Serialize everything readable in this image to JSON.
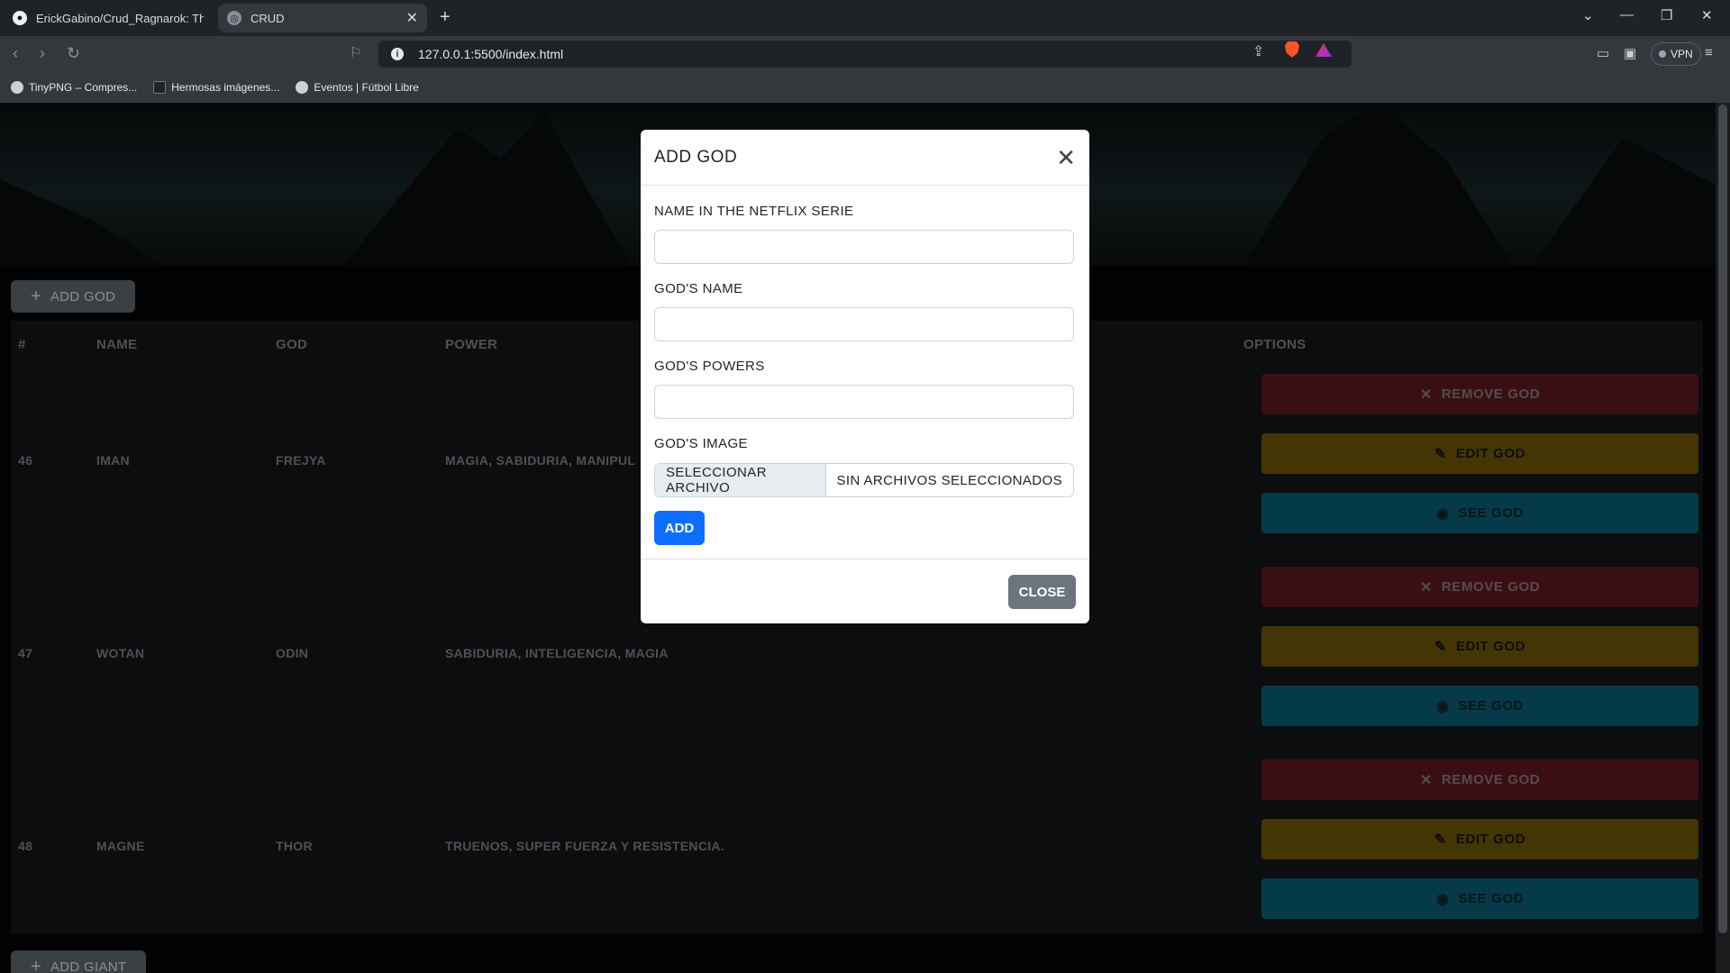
{
  "browser": {
    "tabs": [
      {
        "label": "ErickGabino/Crud_Ragnarok: This is",
        "icon": "github-icon"
      },
      {
        "label": "CRUD",
        "icon": "globe-icon"
      }
    ],
    "url": "127.0.0.1:5500/index.html",
    "vpn_label": "VPN",
    "bookmarks": [
      {
        "label": "TinyPNG – Compres..."
      },
      {
        "label": "Hermosas imágenes..."
      },
      {
        "label": "Eventos | Fútbol Libre"
      }
    ]
  },
  "page": {
    "add_god_button": "ADD GOD",
    "add_giant_button": "ADD GIANT",
    "table": {
      "headers": [
        "#",
        "NAME",
        "GOD",
        "POWER",
        "OPTIONS"
      ],
      "rows": [
        {
          "id": "46",
          "name": "IMAN",
          "god": "FREJYA",
          "power": "MAGIA, SABIDURIA, MANIPUL"
        },
        {
          "id": "47",
          "name": "WOTAN",
          "god": "ODIN",
          "power": "SABIDURIA, INTELIGENCIA, MAGIA"
        },
        {
          "id": "48",
          "name": "MAGNE",
          "god": "THOR",
          "power": "TRUENOS, SUPER FUERZA Y RESISTENCIA."
        }
      ],
      "actions": {
        "remove": "REMOVE GOD",
        "edit": "EDIT GOD",
        "see": "SEE GOD"
      }
    }
  },
  "modal": {
    "title": "ADD GOD",
    "fields": {
      "netflix_name_label": "NAME IN THE NETFLIX SERIE",
      "netflix_name_value": "",
      "god_name_label": "GOD'S NAME",
      "god_name_value": "",
      "god_powers_label": "GOD'S POWERS",
      "god_powers_value": "",
      "god_image_label": "GOD'S IMAGE",
      "file_button": "SELECCIONAR ARCHIVO",
      "file_status": "SIN ARCHIVOS SELECCIONADOS"
    },
    "add_button": "ADD",
    "close_button": "CLOSE"
  },
  "colors": {
    "remove": "#6b1d24",
    "edit": "#7a6208",
    "see": "#0a6b85",
    "primary": "#0d6efd",
    "secondary": "#6c757d"
  }
}
